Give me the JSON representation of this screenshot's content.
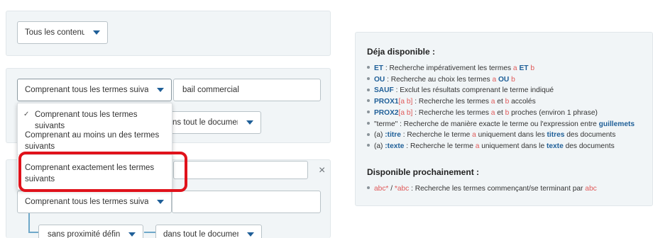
{
  "filter": {
    "content_select": "Tous les contenus"
  },
  "group1": {
    "terms_select": "Comprenant tous les termes suivants",
    "terms_input": "bail commercial",
    "scope_select_partial": "ns tout le document"
  },
  "dropdown": {
    "options": [
      {
        "label": "Comprenant tous les termes suivants",
        "checked": true
      },
      {
        "label_line1": "Comprenant au moins un des termes",
        "label_line2": "suivants"
      },
      {
        "label_line1": "Comprenant exactement les termes",
        "label_line2": "suivants"
      }
    ],
    "check_icon": "✓"
  },
  "group2": {
    "close_icon": "×",
    "terms_select": "Comprenant tous les termes suivants",
    "proximity_select": "sans proximité définie",
    "scope_select": "dans tout le document"
  },
  "info": {
    "available_title": "Déja disponible :",
    "items": [
      {
        "kw": "ET",
        "t1": " : Recherche impérativement les termes ",
        "a": "a",
        "kw2": "ET",
        "b": "b"
      },
      {
        "kw": "OU",
        "t1": " : Recherche au choix les termes ",
        "a": "a",
        "kw2": "OU",
        "b": "b"
      },
      {
        "kw": "SAUF",
        "t1": " : Exclut les résultats comprenant le terme indiqué"
      },
      {
        "kw": "PROX1",
        "br": "[a b]",
        "t1": " : Recherche les termes ",
        "a": "a",
        "t2": " et ",
        "b": "b",
        "t3": " accolés"
      },
      {
        "kw": "PROX2",
        "br": "[a b]",
        "t1": " : Recherche les termes ",
        "a": "a",
        "t2": " et ",
        "b": "b",
        "t3": " proches (environ 1 phrase)"
      },
      {
        "t0": "\"terme\"",
        "t1": " : Recherche de manière exacte le terme ou l'expression entre ",
        "kw": "guillemets"
      },
      {
        "t0": "(a) ",
        "kw": ":titre",
        "t1": " : Recherche le terme ",
        "a": "a",
        "t2": " uniquement dans les ",
        "kw2": "titres",
        "t3": " des documents"
      },
      {
        "t0": "(a) ",
        "kw": ":texte",
        "t1": " : Recherche le terme ",
        "a": "a",
        "t2": " uniquement dans le ",
        "kw2": "texte",
        "t3": " des documents"
      }
    ],
    "upcoming_title": "Disponible prochainement :",
    "upcoming": {
      "v1": "abc*",
      "sep": " / ",
      "v2": "*abc",
      "t1": " : Recherche les termes commençant/se terminant par ",
      "v3": "abc"
    },
    "colors": {
      "keyword": "#1f5f98",
      "variable": "#e05a5a",
      "highlight": "#e0121b"
    }
  }
}
